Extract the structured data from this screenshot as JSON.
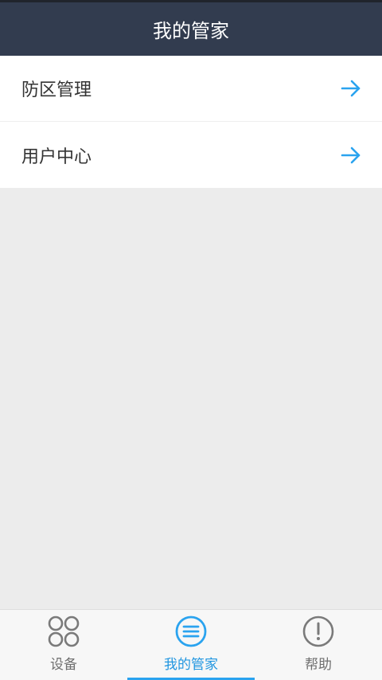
{
  "header": {
    "title": "我的管家"
  },
  "menu": {
    "items": [
      {
        "label": "防区管理",
        "icon": "arrow-right-icon"
      },
      {
        "label": "用户中心",
        "icon": "arrow-right-icon"
      }
    ]
  },
  "tabbar": {
    "tabs": [
      {
        "label": "设备",
        "icon": "devices-grid-icon",
        "active": false
      },
      {
        "label": "我的管家",
        "icon": "list-menu-icon",
        "active": true
      },
      {
        "label": "帮助",
        "icon": "exclamation-circle-icon",
        "active": false
      }
    ]
  },
  "colors": {
    "header_bg": "#323c4f",
    "accent": "#2aa3ef",
    "inactive_icon": "#7a7a7a",
    "background": "#ececec"
  }
}
